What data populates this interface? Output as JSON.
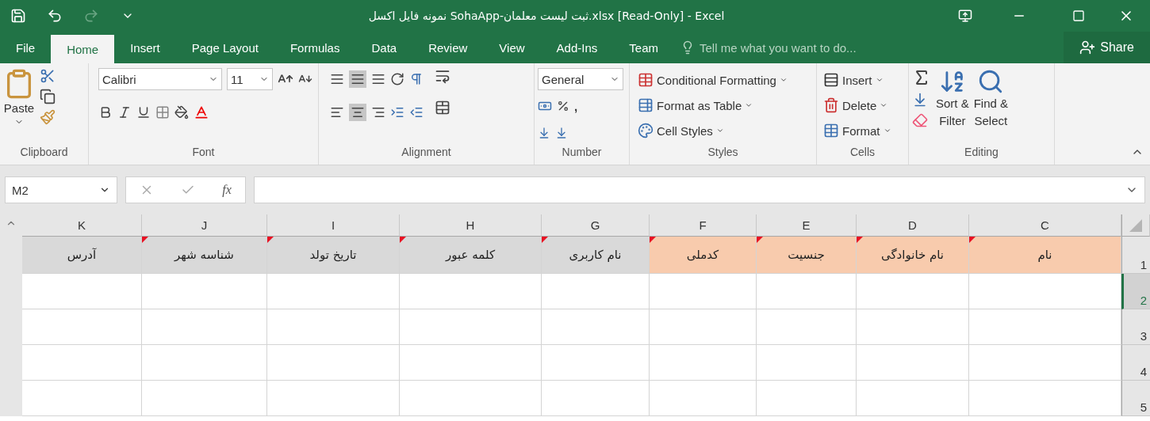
{
  "title_bar": {
    "title": "نمونه فایل اکسل SohaApp-ثبت لیست معلمان.xlsx  [Read-Only] - Excel"
  },
  "tabs": [
    {
      "label": "File",
      "selected": false
    },
    {
      "label": "Home",
      "selected": true
    },
    {
      "label": "Insert",
      "selected": false
    },
    {
      "label": "Page Layout",
      "selected": false
    },
    {
      "label": "Formulas",
      "selected": false
    },
    {
      "label": "Data",
      "selected": false
    },
    {
      "label": "Review",
      "selected": false
    },
    {
      "label": "View",
      "selected": false
    },
    {
      "label": "Add-Ins",
      "selected": false
    },
    {
      "label": "Team",
      "selected": false
    }
  ],
  "tell_me": {
    "placeholder": "Tell me what you want to do..."
  },
  "share": "Share",
  "ribbon": {
    "clipboard": {
      "paste": "Paste",
      "label": "Clipboard"
    },
    "font": {
      "name": "Calibri",
      "size": "11",
      "label": "Font"
    },
    "alignment": {
      "label": "Alignment"
    },
    "number": {
      "format": "General",
      "comma": ",",
      "label": "Number"
    },
    "styles": {
      "items": [
        "Conditional Formatting",
        "Format as Table",
        "Cell Styles"
      ],
      "label": "Styles"
    },
    "cells": {
      "items": [
        "Insert",
        "Delete",
        "Format"
      ],
      "label": "Cells"
    },
    "editing": {
      "sort": [
        "Sort &",
        "Filter"
      ],
      "find": [
        "Find &",
        "Select"
      ],
      "label": "Editing"
    }
  },
  "formula_bar": {
    "name_box": "M2",
    "function_button": "fx"
  },
  "sheet": {
    "columns": [
      "K",
      "J",
      "I",
      "H",
      "G",
      "F",
      "E",
      "D",
      "C"
    ],
    "header_cells": [
      {
        "text": "نام",
        "color": "#f8cbad",
        "comment": true
      },
      {
        "text": "نام خانوادگی",
        "color": "#f8cbad",
        "comment": true
      },
      {
        "text": "جنسیت",
        "color": "#f8cbad",
        "comment": true
      },
      {
        "text": "کدملی",
        "color": "#f8cbad",
        "comment": true
      },
      {
        "text": "نام کاربری",
        "color": "#d9d9d9",
        "comment": true
      },
      {
        "text": "کلمه عبور",
        "color": "#d9d9d9",
        "comment": true
      },
      {
        "text": "تاریخ تولد",
        "color": "#d9d9d9",
        "comment": true
      },
      {
        "text": "شناسه شهر",
        "color": "#d9d9d9",
        "comment": true
      },
      {
        "text": "آدرس",
        "color": "#d9d9d9",
        "comment": false
      }
    ],
    "rows": [
      {
        "number": "1",
        "selected": false
      },
      {
        "number": "2",
        "selected": true
      },
      {
        "number": "3",
        "selected": false
      },
      {
        "number": "4",
        "selected": false
      },
      {
        "number": "5",
        "selected": false
      }
    ]
  }
}
